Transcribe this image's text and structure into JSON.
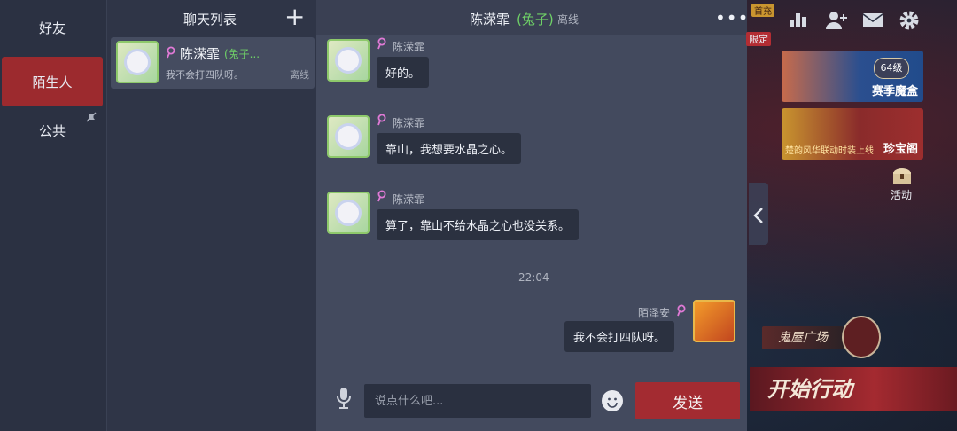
{
  "tabs": [
    {
      "label": "好友"
    },
    {
      "label": "陌生人"
    },
    {
      "label": "公共"
    }
  ],
  "list": {
    "title": "聊天列表",
    "add_symbol": "+",
    "conversations": [
      {
        "name": "陈溁霏",
        "tag": "(兔子...",
        "preview": "我不会打四队呀。",
        "status": "离线"
      }
    ]
  },
  "chat": {
    "name": "陈溁霏",
    "tag": "(兔子)",
    "status": "离线",
    "more_symbol": "•••",
    "messages": [
      {
        "sender": "陈溁霏",
        "text": "好的。"
      },
      {
        "sender": "陈溁霏",
        "text": "靠山，我想要水晶之心。"
      },
      {
        "sender": "陈溁霏",
        "text": "算了，靠山不给水晶之心也没关系。"
      }
    ],
    "time": "22:04",
    "my_message": {
      "sender": "陌泽安",
      "text": "我不会打四队呀。"
    },
    "input_placeholder": "说点什么吧...",
    "send_label": "发送"
  },
  "game": {
    "banner1_label": "赛季魔盒",
    "banner1_level": "64级",
    "banner2_label": "珍宝阁",
    "banner2_sub": "楚韵风华联动时装上线",
    "limited": "限定",
    "first_charge": "首充",
    "activity_label": "活动",
    "plaza_label": "鬼屋广场",
    "start_label": "开始行动"
  },
  "icons": {
    "mute": "bell-off",
    "pin": "map-pin",
    "mic": "microphone",
    "emoji": "smiley",
    "collapse": "chevron-left",
    "ranking": "bar-chart",
    "add_friend": "person-plus",
    "mail": "envelope",
    "settings": "gear"
  }
}
